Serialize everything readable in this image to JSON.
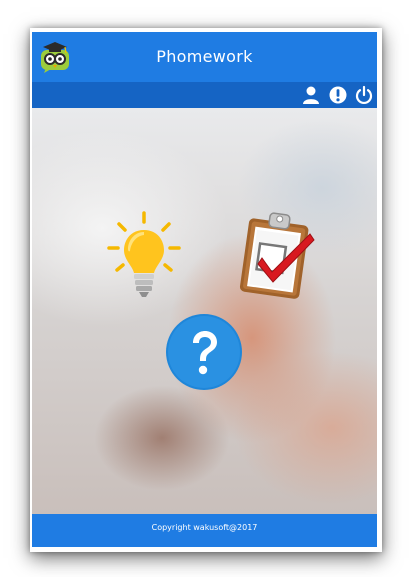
{
  "app": {
    "title": "Phomework",
    "brand_color": "#1f7ce3",
    "toolbar_color": "#1564c4"
  },
  "header": {
    "logo_icon": "owl-graduation-cap-icon"
  },
  "toolbar": {
    "items": [
      {
        "icon": "user-icon"
      },
      {
        "icon": "info-icon"
      },
      {
        "icon": "power-icon"
      }
    ]
  },
  "main": {
    "buttons": [
      {
        "icon": "lightbulb-icon"
      },
      {
        "icon": "clipboard-checkmark-icon"
      },
      {
        "icon": "question-mark-icon"
      }
    ]
  },
  "footer": {
    "copyright": "Copyright wakusoft@2017"
  }
}
